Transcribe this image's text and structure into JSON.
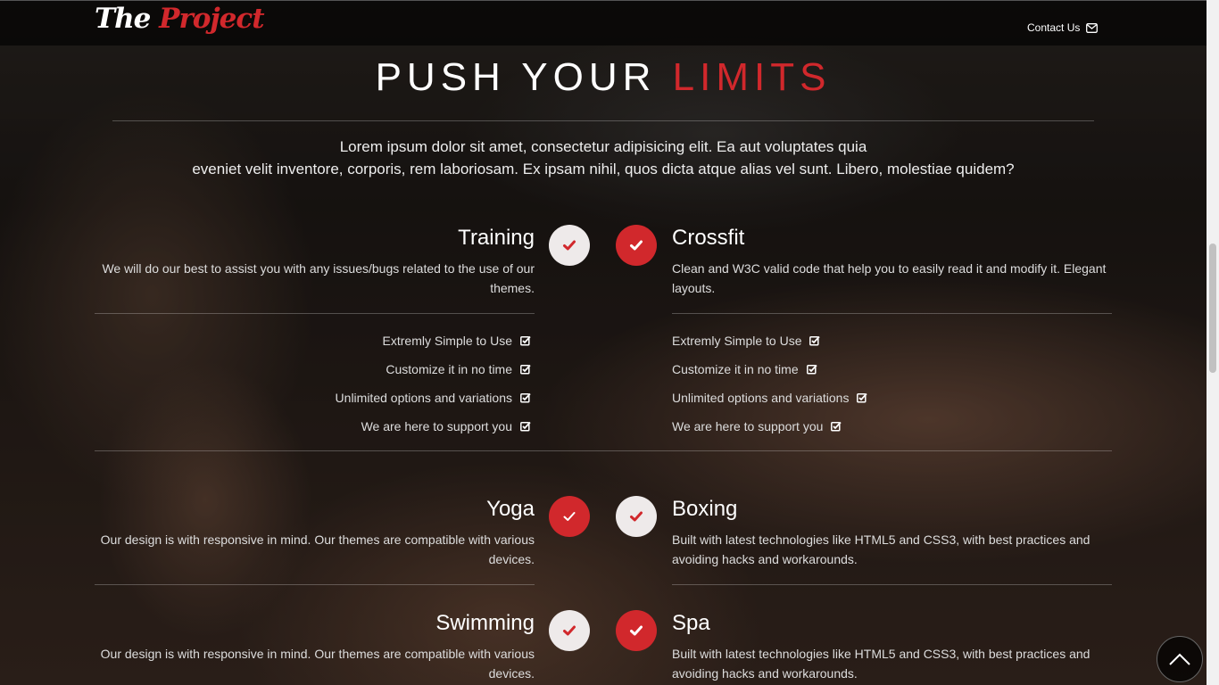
{
  "header": {
    "logo_the": "The",
    "logo_project": "Project",
    "contact_label": "Contact Us"
  },
  "hero": {
    "title_white": "PUSH YOUR",
    "title_red": "LIMITS",
    "lead_line1": "Lorem ipsum dolor sit amet, consectetur adipisicing elit. Ea aut voluptates quia",
    "lead_line2": "eveniet velit inventore, corporis, rem laboriosam. Ex ipsam nihil, quos dicta atque alias vel sunt. Libero, molestiae quidem?"
  },
  "features": {
    "training": {
      "title": "Training",
      "desc": "We will do our best to assist you with any issues/bugs related to the use of our themes.",
      "list": [
        "Extremly Simple to Use",
        "Customize it in no time",
        "Unlimited options and variations",
        "We are here to support you"
      ]
    },
    "crossfit": {
      "title": "Crossfit",
      "desc": "Clean and W3C valid code that help you to easily read it and modify it. Elegant layouts.",
      "list": [
        "Extremly Simple to Use",
        "Customize it in no time",
        "Unlimited options and variations",
        "We are here to support you"
      ]
    },
    "yoga": {
      "title": "Yoga",
      "desc": "Our design is with responsive in mind. Our themes are compatible with various devices."
    },
    "boxing": {
      "title": "Boxing",
      "desc": "Built with latest technologies like HTML5 and CSS3, with best practices and avoiding hacks and workarounds."
    },
    "swimming": {
      "title": "Swimming",
      "desc": "Our design is with responsive in mind. Our themes are compatible with various devices."
    },
    "spa": {
      "title": "Spa",
      "desc": "Built with latest technologies like HTML5 and CSS3, with best practices and avoiding hacks and workarounds."
    }
  },
  "icons": {
    "check": "check-icon",
    "check_square": "check-square-icon",
    "envelope": "envelope-icon",
    "chevron_up": "chevron-up-icon"
  },
  "colors": {
    "accent": "#d1282c",
    "circle_light": "#eeeaea"
  }
}
